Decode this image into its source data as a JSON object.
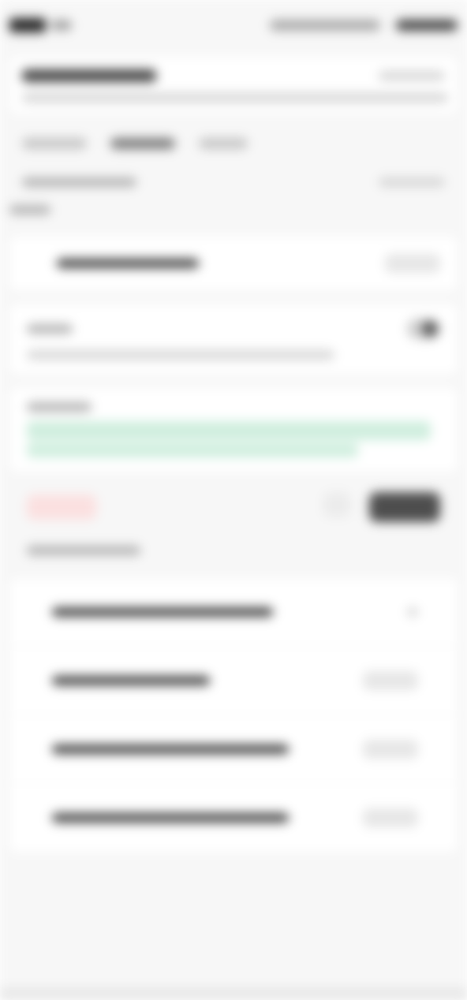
{
  "notice": "",
  "colors": {
    "background": "#f7f7f7",
    "card": "#ffffff",
    "primary_button": "#4d4d4d",
    "danger_chip": "#fbe0e0",
    "success_box": "#cfeede"
  },
  "icons": [
    "avatar-icon",
    "chevron-down-icon",
    "search-icon",
    "filter-icon",
    "more-icon"
  ]
}
